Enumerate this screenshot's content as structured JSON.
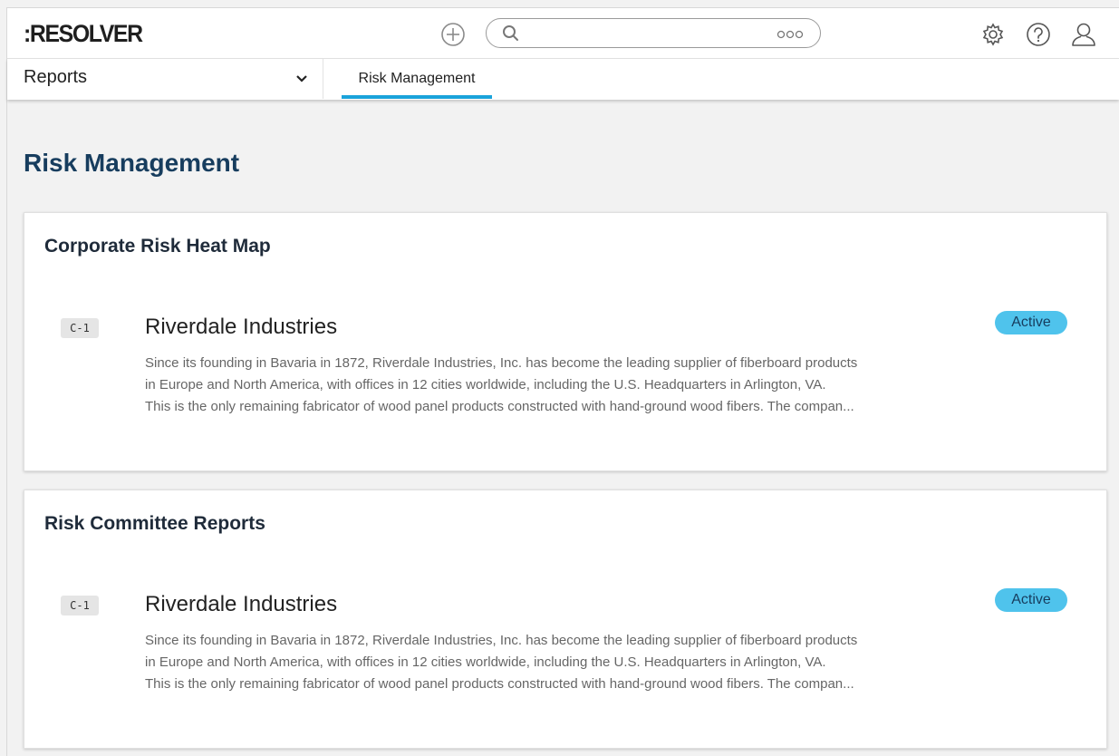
{
  "header": {
    "logo": ":RESOLVER",
    "search_placeholder": ""
  },
  "nav": {
    "dropdown_label": "Reports",
    "tabs": [
      {
        "label": "Risk Management",
        "active": true
      }
    ]
  },
  "page": {
    "title": "Risk Management"
  },
  "sections": [
    {
      "title": "Corporate Risk Heat Map",
      "items": [
        {
          "code": "C-1",
          "name": "Riverdale Industries",
          "status": "Active",
          "description": [
            "Since its founding in Bavaria in 1872, Riverdale Industries, Inc. has become the leading supplier of fiberboard products",
            "in Europe and North America, with offices in 12 cities worldwide, including the U.S. Headquarters in Arlington, VA.",
            "This is the only remaining fabricator of wood panel products constructed with hand-ground wood fibers. The compan..."
          ]
        }
      ]
    },
    {
      "title": "Risk Committee Reports",
      "items": [
        {
          "code": "C-1",
          "name": "Riverdale Industries",
          "status": "Active",
          "description": [
            "Since its founding in Bavaria in 1872, Riverdale Industries, Inc. has become the leading supplier of fiberboard products",
            "in Europe and North America, with offices in 12 cities worldwide, including the U.S. Headquarters in Arlington, VA.",
            "This is the only remaining fabricator of wood panel products constructed with hand-ground wood fibers. The compan..."
          ]
        }
      ]
    }
  ],
  "colors": {
    "accent": "#1aa3db",
    "status_active": "#4fc3ec",
    "title_navy": "#173d5e",
    "background": "#f2f2f2"
  },
  "icons": [
    "plus-circle-icon",
    "search-icon",
    "more-icon",
    "gear-icon",
    "help-icon",
    "user-icon",
    "chevron-down-icon"
  ]
}
